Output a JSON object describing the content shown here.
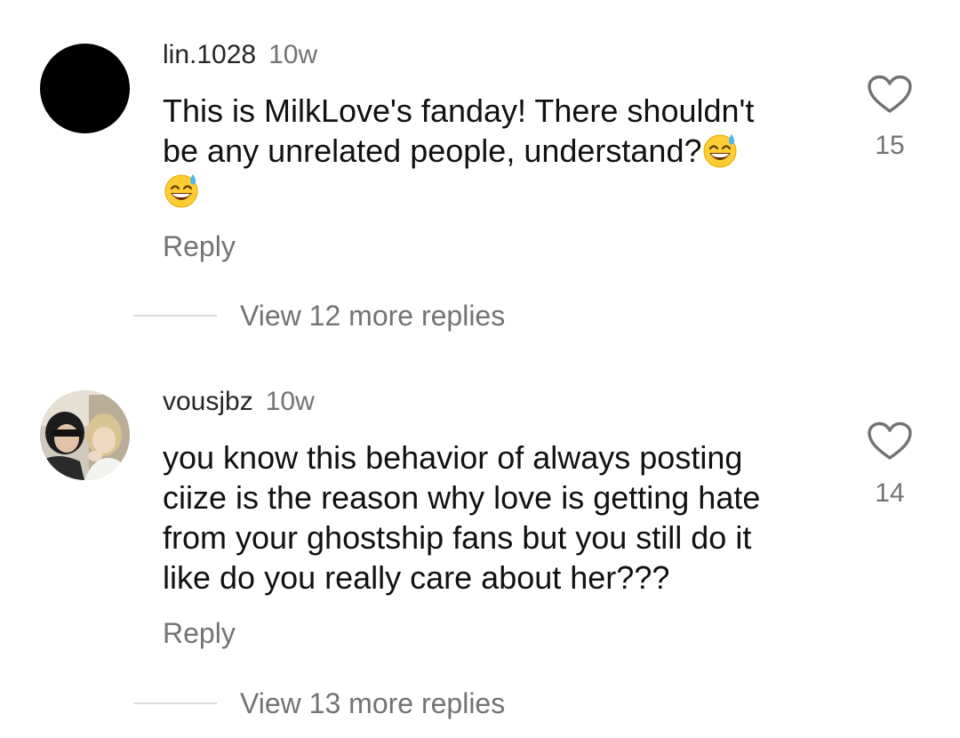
{
  "comments": [
    {
      "username": "lin.1028",
      "time": "10w",
      "avatar": "black-circle-avatar",
      "lines": [
        "This is MilkLove's fanday! There shouldn't",
        "be any unrelated people, understand?"
      ],
      "emoji": "grinning-face-with-sweat",
      "likes": "15",
      "reply_label": "Reply",
      "view_replies_label": "View 12 more replies"
    },
    {
      "username": "vousjbz",
      "time": "10w",
      "avatar": "photo-avatar",
      "lines": [
        "you know this behavior of always posting",
        "ciize is the reason why love is getting hate",
        "from your ghostship fans but you still do it",
        "like do you really care about her???"
      ],
      "likes": "14",
      "reply_label": "Reply",
      "view_replies_label": "View 13 more replies"
    }
  ],
  "colors": {
    "text": "#111111",
    "secondary": "#737373",
    "divider": "#dbdbdb"
  },
  "icons": {
    "like": "heart-outline-icon"
  }
}
